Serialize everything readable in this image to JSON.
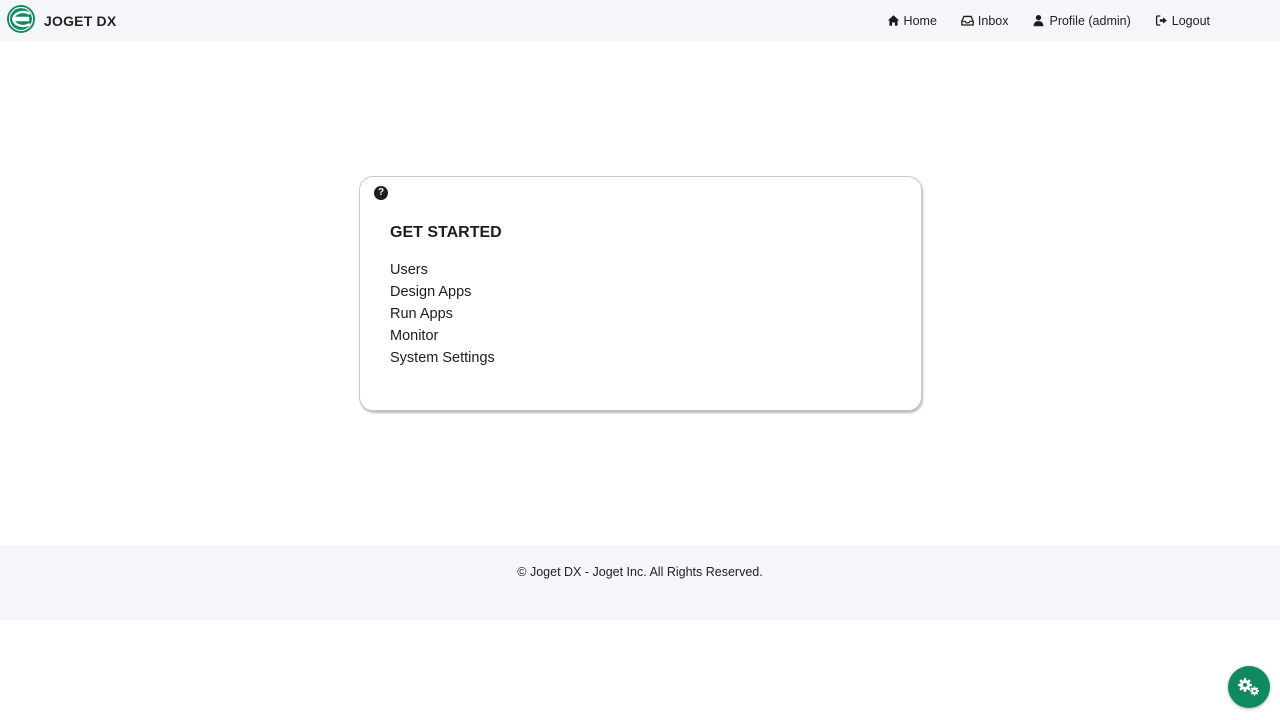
{
  "header": {
    "brand_name": "JOGET DX",
    "nav": [
      {
        "label": "Home",
        "icon": "home-icon"
      },
      {
        "label": "Inbox",
        "icon": "inbox-icon"
      },
      {
        "label": "Profile (admin)",
        "icon": "user-icon"
      },
      {
        "label": "Logout",
        "icon": "logout-icon"
      }
    ]
  },
  "card": {
    "help_glyph": "?",
    "title": "GET STARTED",
    "links": [
      "Users",
      "Design Apps",
      "Run Apps",
      "Monitor",
      "System Settings"
    ]
  },
  "footer": {
    "text": "© Joget DX - Joget Inc. All Rights Reserved."
  },
  "fab": {
    "icon": "cogs-icon"
  },
  "colors": {
    "brand_green": "#0f8a5f",
    "header_bg": "#f5f6f9",
    "footer_bg": "#f5f6f9",
    "text": "#222222"
  }
}
